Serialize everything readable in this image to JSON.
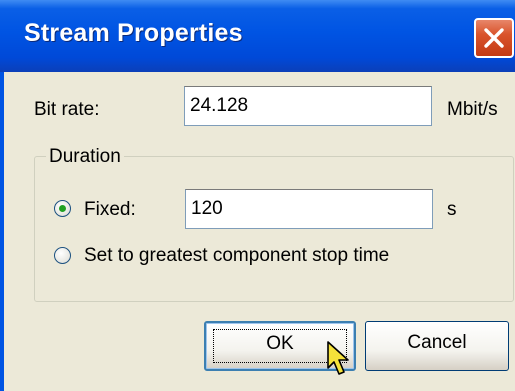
{
  "window": {
    "title": "Stream Properties",
    "close_icon": "close-icon"
  },
  "bit_rate": {
    "label": "Bit rate:",
    "value": "24.128",
    "unit": "Mbit/s"
  },
  "duration": {
    "group_label": "Duration",
    "fixed": {
      "label": "Fixed:",
      "selected": true,
      "value": "120",
      "unit": "s"
    },
    "greatest": {
      "label": "Set to greatest component stop time",
      "selected": false
    }
  },
  "buttons": {
    "ok_label": "OK",
    "cancel_label": "Cancel"
  },
  "colors": {
    "title_bar": "#0054e3",
    "client_bg": "#ece9d8",
    "close_button": "#d9542c",
    "radio_dot": "#21a121"
  },
  "cursor": "arrow-pointer-icon"
}
